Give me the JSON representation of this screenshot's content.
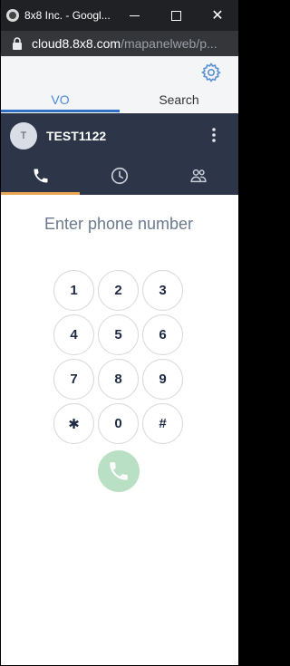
{
  "window": {
    "title": "8x8 Inc. - Googl...",
    "minimize_icon": "minimize-icon",
    "maximize_icon": "maximize-icon",
    "close_icon": "close-icon",
    "close_glyph": "✕"
  },
  "address_bar": {
    "host": "cloud8.8x8.com",
    "path": "/mapanelweb/p..."
  },
  "header": {
    "settings_icon": "gear-icon",
    "tabs": [
      {
        "label": "VO",
        "active": true
      },
      {
        "label": "Search",
        "active": false
      }
    ]
  },
  "user": {
    "avatar_initial": "T",
    "name": "TEST1122",
    "menu_icon": "kebab-icon"
  },
  "nav": {
    "items": [
      {
        "icon": "phone-icon",
        "active": true
      },
      {
        "icon": "clock-icon",
        "active": false
      },
      {
        "icon": "contacts-icon",
        "active": false
      }
    ],
    "active_color": "#e8a552"
  },
  "dialer": {
    "placeholder": "Enter phone number",
    "value": "",
    "keys": [
      "1",
      "2",
      "3",
      "4",
      "5",
      "6",
      "7",
      "8",
      "9",
      "✱",
      "0",
      "#"
    ],
    "call_button_color": "#b9dfc4"
  },
  "colors": {
    "accent_blue": "#2f6fc6",
    "userbar_bg": "#2c3648"
  }
}
